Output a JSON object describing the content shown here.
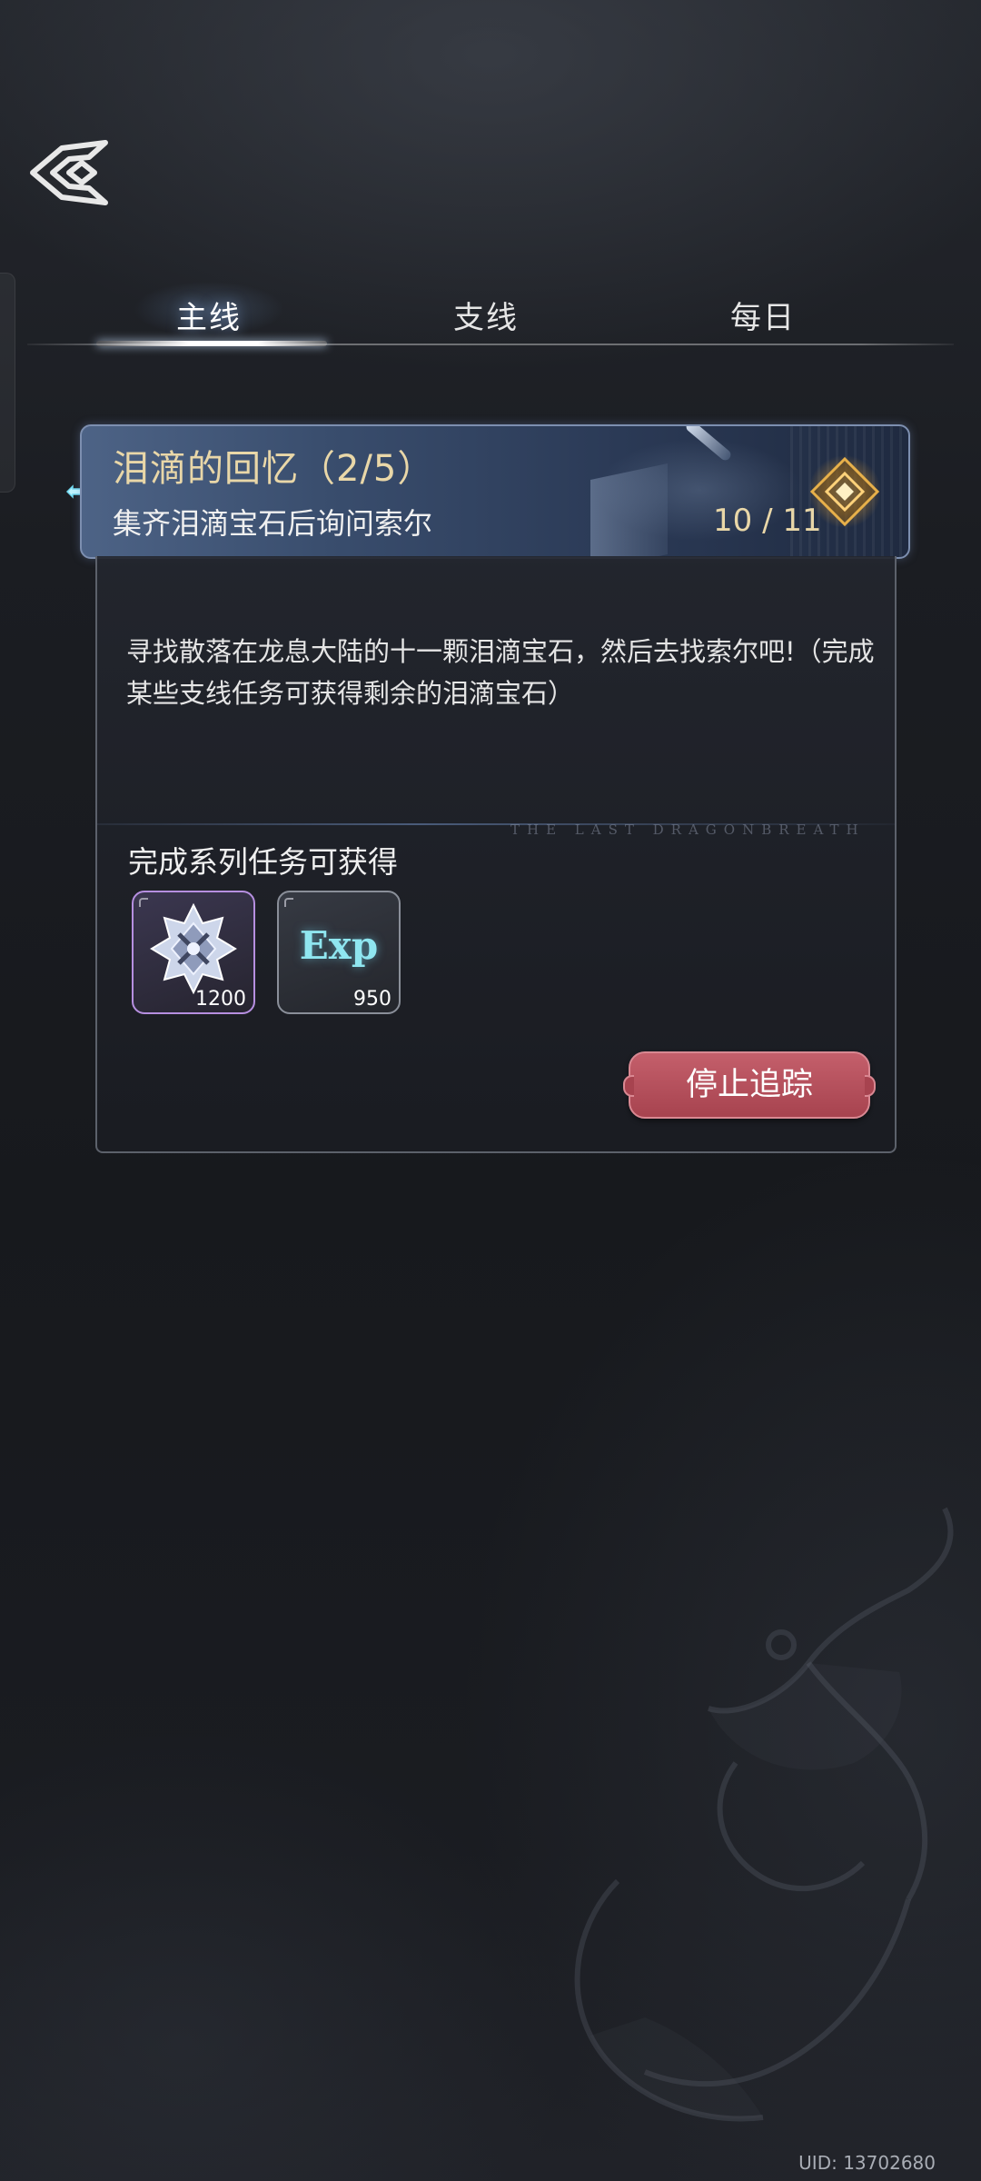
{
  "tabs": [
    {
      "label": "主线",
      "active": true
    },
    {
      "label": "支线",
      "active": false
    },
    {
      "label": "每日",
      "active": false
    }
  ],
  "quest": {
    "title": "泪滴的回忆（2/5）",
    "subtitle": "集齐泪滴宝石后询问索尔",
    "progress_text": "10 / 11",
    "description": "寻找散落在龙息大陆的十一颗泪滴宝石，然后去找索尔吧!（完成某些支线任务可获得剩余的泪滴宝石）",
    "watermark": "THE LAST DRAGONBREATH",
    "rewards_label": "完成系列任务可获得",
    "rewards": [
      {
        "icon": "crystal-medal-icon",
        "quantity": "1200",
        "rarity_color": "#b68fe0"
      },
      {
        "label": "Exp",
        "icon": "exp-icon",
        "quantity": "950",
        "rarity_color": "#8a8f99"
      }
    ],
    "stop_button": "停止追踪"
  },
  "colors": {
    "accent_gold": "#e9d7a8",
    "button_red": "#b34f5a",
    "tab_active": "#ffffff"
  },
  "footer": {
    "uid": "UID: 13702680"
  }
}
